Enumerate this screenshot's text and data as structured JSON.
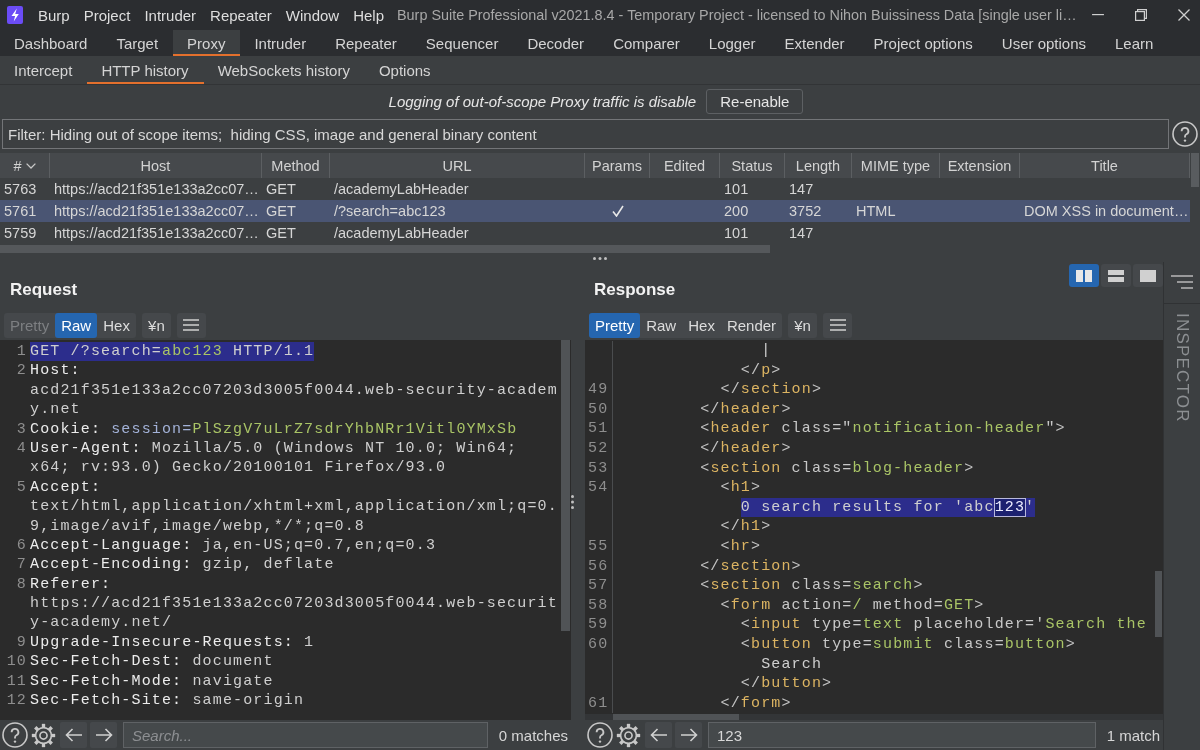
{
  "window": {
    "title": "Burp Suite Professional v2021.8.4 - Temporary Project - licensed to Nihon Buissiness Data [single user li…"
  },
  "menu": [
    "Burp",
    "Project",
    "Intruder",
    "Repeater",
    "Window",
    "Help"
  ],
  "main_tabs": [
    {
      "label": "Dashboard",
      "selected": false
    },
    {
      "label": "Target",
      "selected": false
    },
    {
      "label": "Proxy",
      "selected": true
    },
    {
      "label": "Intruder",
      "selected": false
    },
    {
      "label": "Repeater",
      "selected": false
    },
    {
      "label": "Sequencer",
      "selected": false
    },
    {
      "label": "Decoder",
      "selected": false
    },
    {
      "label": "Comparer",
      "selected": false
    },
    {
      "label": "Logger",
      "selected": false
    },
    {
      "label": "Extender",
      "selected": false
    },
    {
      "label": "Project options",
      "selected": false
    },
    {
      "label": "User options",
      "selected": false
    },
    {
      "label": "Learn",
      "selected": false
    }
  ],
  "sub_tabs": [
    {
      "label": "Intercept",
      "selected": false
    },
    {
      "label": "HTTP history",
      "selected": true
    },
    {
      "label": "WebSockets history",
      "selected": false
    },
    {
      "label": "Options",
      "selected": false
    }
  ],
  "notice": {
    "text": "Logging of out-of-scope Proxy traffic is disable",
    "button": "Re-enable"
  },
  "filter": "Filter: Hiding out of scope items;  hiding CSS, image and general binary content",
  "table": {
    "columns": [
      {
        "label": "#",
        "sorted": true
      },
      {
        "label": "Host",
        "sorted": false
      },
      {
        "label": "Method",
        "sorted": false
      },
      {
        "label": "URL",
        "sorted": false
      },
      {
        "label": "Params",
        "sorted": false
      },
      {
        "label": "Edited",
        "sorted": false
      },
      {
        "label": "Status",
        "sorted": false
      },
      {
        "label": "Length",
        "sorted": false
      },
      {
        "label": "MIME type",
        "sorted": false
      },
      {
        "label": "Extension",
        "sorted": false
      },
      {
        "label": "Title",
        "sorted": false
      }
    ],
    "rows": [
      {
        "selected": false,
        "number": "5763",
        "host": "https://acd21f351e133a2cc07…",
        "method": "GET",
        "url": "/academyLabHeader",
        "params": false,
        "status": "101",
        "length": "147"
      },
      {
        "selected": true,
        "number": "5761",
        "host": "https://acd21f351e133a2cc07…",
        "method": "GET",
        "url": "/?search=abc123",
        "params": true,
        "status": "200",
        "length": "3752",
        "mime_type": "HTML",
        "title": "DOM XSS in document…"
      },
      {
        "selected": false,
        "number": "5759",
        "host": "https://acd21f351e133a2cc07…",
        "method": "GET",
        "url": "/academyLabHeader",
        "params": false,
        "status": "101",
        "length": "147"
      }
    ]
  },
  "request": {
    "title": "Request",
    "views": [
      {
        "label": "Pretty",
        "selected": false,
        "disabled": true
      },
      {
        "label": "Raw",
        "selected": true,
        "disabled": false
      },
      {
        "label": "Hex",
        "selected": false,
        "disabled": false
      }
    ],
    "buttons": [
      "¥n"
    ],
    "lines": [
      {
        "number": "1",
        "highlighted": true,
        "tokens": [
          {
            "kind": "plain",
            "text": "GET /?search="
          },
          {
            "kind": "value",
            "text": "abc123"
          },
          {
            "kind": "plain",
            "text": " HTTP/1.1"
          }
        ]
      },
      {
        "number": "2",
        "highlighted": false,
        "tokens": [
          {
            "kind": "name",
            "text": "Host:"
          }
        ]
      },
      {
        "highlighted": false,
        "tokens": [
          {
            "kind": "plain",
            "text": "acd21f351e133a2cc07203d3005f0044.web-security-academ"
          }
        ]
      },
      {
        "highlighted": false,
        "tokens": [
          {
            "kind": "plain",
            "text": "y.net"
          }
        ]
      },
      {
        "number": "3",
        "highlighted": false,
        "tokens": [
          {
            "kind": "name",
            "text": "Cookie:"
          },
          {
            "kind": "param",
            "text": " session="
          },
          {
            "kind": "value",
            "text": "PlSzgV7uLrZ7sdrYhbNRr1Vitl0YMxSb"
          }
        ]
      },
      {
        "number": "4",
        "highlighted": false,
        "tokens": [
          {
            "kind": "name",
            "text": "User-Agent:"
          },
          {
            "kind": "plain",
            "text": " Mozilla/5.0 (Windows NT 10.0; Win64;"
          }
        ]
      },
      {
        "highlighted": false,
        "tokens": [
          {
            "kind": "plain",
            "text": "x64; rv:93.0) Gecko/20100101 Firefox/93.0"
          }
        ]
      },
      {
        "number": "5",
        "highlighted": false,
        "tokens": [
          {
            "kind": "name",
            "text": "Accept:"
          }
        ]
      },
      {
        "highlighted": false,
        "tokens": [
          {
            "kind": "plain",
            "text": "text/html,application/xhtml+xml,application/xml;q=0."
          }
        ]
      },
      {
        "highlighted": false,
        "tokens": [
          {
            "kind": "plain",
            "text": "9,image/avif,image/webp,*/*;q=0.8"
          }
        ]
      },
      {
        "number": "6",
        "highlighted": false,
        "tokens": [
          {
            "kind": "name",
            "text": "Accept-Language:"
          },
          {
            "kind": "plain",
            "text": " ja,en-US;q=0.7,en;q=0.3"
          }
        ]
      },
      {
        "number": "7",
        "highlighted": false,
        "tokens": [
          {
            "kind": "name",
            "text": "Accept-Encoding:"
          },
          {
            "kind": "plain",
            "text": " gzip, deflate"
          }
        ]
      },
      {
        "number": "8",
        "highlighted": false,
        "tokens": [
          {
            "kind": "name",
            "text": "Referer:"
          }
        ]
      },
      {
        "highlighted": false,
        "tokens": [
          {
            "kind": "plain",
            "text": "https://acd21f351e133a2cc07203d3005f0044.web-securit"
          }
        ]
      },
      {
        "highlighted": false,
        "tokens": [
          {
            "kind": "plain",
            "text": "y-academy.net/"
          }
        ]
      },
      {
        "number": "9",
        "highlighted": false,
        "tokens": [
          {
            "kind": "name",
            "text": "Upgrade-Insecure-Requests:"
          },
          {
            "kind": "plain",
            "text": " 1"
          }
        ]
      },
      {
        "number": "10",
        "highlighted": false,
        "tokens": [
          {
            "kind": "name",
            "text": "Sec-Fetch-Dest:"
          },
          {
            "kind": "plain",
            "text": " document"
          }
        ]
      },
      {
        "number": "11",
        "highlighted": false,
        "tokens": [
          {
            "kind": "name",
            "text": "Sec-Fetch-Mode:"
          },
          {
            "kind": "plain",
            "text": " navigate"
          }
        ]
      },
      {
        "number": "12",
        "highlighted": false,
        "tokens": [
          {
            "kind": "name",
            "text": "Sec-Fetch-Site:"
          },
          {
            "kind": "plain",
            "text": " same-origin"
          }
        ]
      }
    ],
    "search": {
      "placeholder": "Search...",
      "matches": "0 matches"
    }
  },
  "response": {
    "title": "Response",
    "layouts": [
      {
        "kind": "columns",
        "selected": true
      },
      {
        "kind": "rows",
        "selected": false
      },
      {
        "kind": "single",
        "selected": false
      }
    ],
    "views": [
      {
        "label": "Pretty",
        "selected": true
      },
      {
        "label": "Raw",
        "selected": false
      },
      {
        "label": "Hex",
        "selected": false
      },
      {
        "label": "Render",
        "selected": false
      }
    ],
    "buttons": [
      "¥n"
    ],
    "lines": [
      {
        "highlighted": false,
        "tokens": [
          {
            "kind": "plain",
            "text": "              |"
          }
        ]
      },
      {
        "highlighted": false,
        "tokens": [
          {
            "kind": "punct",
            "text": "            </"
          },
          {
            "kind": "tag",
            "text": "p"
          },
          {
            "kind": "punct",
            "text": ">"
          }
        ]
      },
      {
        "number": "49",
        "highlighted": false,
        "tokens": [
          {
            "kind": "punct",
            "text": "          </"
          },
          {
            "kind": "tag",
            "text": "section"
          },
          {
            "kind": "punct",
            "text": ">"
          }
        ]
      },
      {
        "number": "50",
        "highlighted": false,
        "tokens": [
          {
            "kind": "punct",
            "text": "        </"
          },
          {
            "kind": "tag",
            "text": "header"
          },
          {
            "kind": "punct",
            "text": ">"
          }
        ]
      },
      {
        "number": "51",
        "highlighted": false,
        "tokens": [
          {
            "kind": "punct",
            "text": "        <"
          },
          {
            "kind": "tag",
            "text": "header"
          },
          {
            "kind": "attr",
            "text": " class=\""
          },
          {
            "kind": "value",
            "text": "notification-header"
          },
          {
            "kind": "attr",
            "text": "\""
          },
          {
            "kind": "punct",
            "text": ">"
          }
        ]
      },
      {
        "number": "52",
        "highlighted": false,
        "tokens": [
          {
            "kind": "punct",
            "text": "        </"
          },
          {
            "kind": "tag",
            "text": "header"
          },
          {
            "kind": "punct",
            "text": ">"
          }
        ]
      },
      {
        "number": "53",
        "highlighted": false,
        "tokens": [
          {
            "kind": "punct",
            "text": "        <"
          },
          {
            "kind": "tag",
            "text": "section"
          },
          {
            "kind": "attr",
            "text": " class="
          },
          {
            "kind": "value",
            "text": "blog-header"
          },
          {
            "kind": "punct",
            "text": ">"
          }
        ]
      },
      {
        "number": "54",
        "highlighted": false,
        "tokens": [
          {
            "kind": "punct",
            "text": "          <"
          },
          {
            "kind": "tag",
            "text": "h1"
          },
          {
            "kind": "punct",
            "text": ">"
          }
        ]
      },
      {
        "highlighted": true,
        "tokens": [
          {
            "kind": "plain",
            "text": "            0 search results for 'abc"
          },
          {
            "kind": "match",
            "text": "123"
          },
          {
            "kind": "plain",
            "text": "'"
          }
        ]
      },
      {
        "highlighted": false,
        "tokens": [
          {
            "kind": "punct",
            "text": "          </"
          },
          {
            "kind": "tag",
            "text": "h1"
          },
          {
            "kind": "punct",
            "text": ">"
          }
        ]
      },
      {
        "number": "55",
        "highlighted": false,
        "tokens": [
          {
            "kind": "punct",
            "text": "          <"
          },
          {
            "kind": "tag",
            "text": "hr"
          },
          {
            "kind": "punct",
            "text": ">"
          }
        ]
      },
      {
        "number": "56",
        "highlighted": false,
        "tokens": [
          {
            "kind": "punct",
            "text": "        </"
          },
          {
            "kind": "tag",
            "text": "section"
          },
          {
            "kind": "punct",
            "text": ">"
          }
        ]
      },
      {
        "number": "57",
        "highlighted": false,
        "tokens": [
          {
            "kind": "punct",
            "text": "        <"
          },
          {
            "kind": "tag",
            "text": "section"
          },
          {
            "kind": "attr",
            "text": " class="
          },
          {
            "kind": "value",
            "text": "search"
          },
          {
            "kind": "punct",
            "text": ">"
          }
        ]
      },
      {
        "number": "58",
        "highlighted": false,
        "tokens": [
          {
            "kind": "punct",
            "text": "          <"
          },
          {
            "kind": "tag",
            "text": "form"
          },
          {
            "kind": "attr",
            "text": " action="
          },
          {
            "kind": "value",
            "text": "/"
          },
          {
            "kind": "attr",
            "text": " method="
          },
          {
            "kind": "value",
            "text": "GET"
          },
          {
            "kind": "punct",
            "text": ">"
          }
        ]
      },
      {
        "number": "59",
        "highlighted": false,
        "tokens": [
          {
            "kind": "punct",
            "text": "            <"
          },
          {
            "kind": "tag",
            "text": "input"
          },
          {
            "kind": "attr",
            "text": " type="
          },
          {
            "kind": "value",
            "text": "text"
          },
          {
            "kind": "attr",
            "text": " placeholder='"
          },
          {
            "kind": "value",
            "text": "Search the"
          }
        ]
      },
      {
        "number": "60",
        "highlighted": false,
        "tokens": [
          {
            "kind": "punct",
            "text": "            <"
          },
          {
            "kind": "tag",
            "text": "button"
          },
          {
            "kind": "attr",
            "text": " type="
          },
          {
            "kind": "value",
            "text": "submit"
          },
          {
            "kind": "attr",
            "text": " class="
          },
          {
            "kind": "value",
            "text": "button"
          },
          {
            "kind": "punct",
            "text": ">"
          }
        ]
      },
      {
        "highlighted": false,
        "tokens": [
          {
            "kind": "plain",
            "text": "              Search"
          }
        ]
      },
      {
        "highlighted": false,
        "tokens": [
          {
            "kind": "punct",
            "text": "            </"
          },
          {
            "kind": "tag",
            "text": "button"
          },
          {
            "kind": "punct",
            "text": ">"
          }
        ]
      },
      {
        "number": "61",
        "highlighted": false,
        "tokens": [
          {
            "kind": "punct",
            "text": "          </"
          },
          {
            "kind": "tag",
            "text": "form"
          },
          {
            "kind": "punct",
            "text": ">"
          }
        ]
      }
    ],
    "search": {
      "value": "123",
      "matches": "1 match"
    }
  },
  "inspector": {
    "title": "INSPECTOR"
  }
}
